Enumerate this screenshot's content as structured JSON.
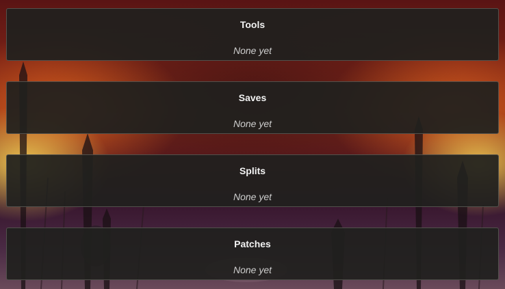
{
  "panels": [
    {
      "title": "Tools",
      "empty_text": "None yet"
    },
    {
      "title": "Saves",
      "empty_text": "None yet"
    },
    {
      "title": "Splits",
      "empty_text": "None yet"
    },
    {
      "title": "Patches",
      "empty_text": "None yet"
    }
  ]
}
